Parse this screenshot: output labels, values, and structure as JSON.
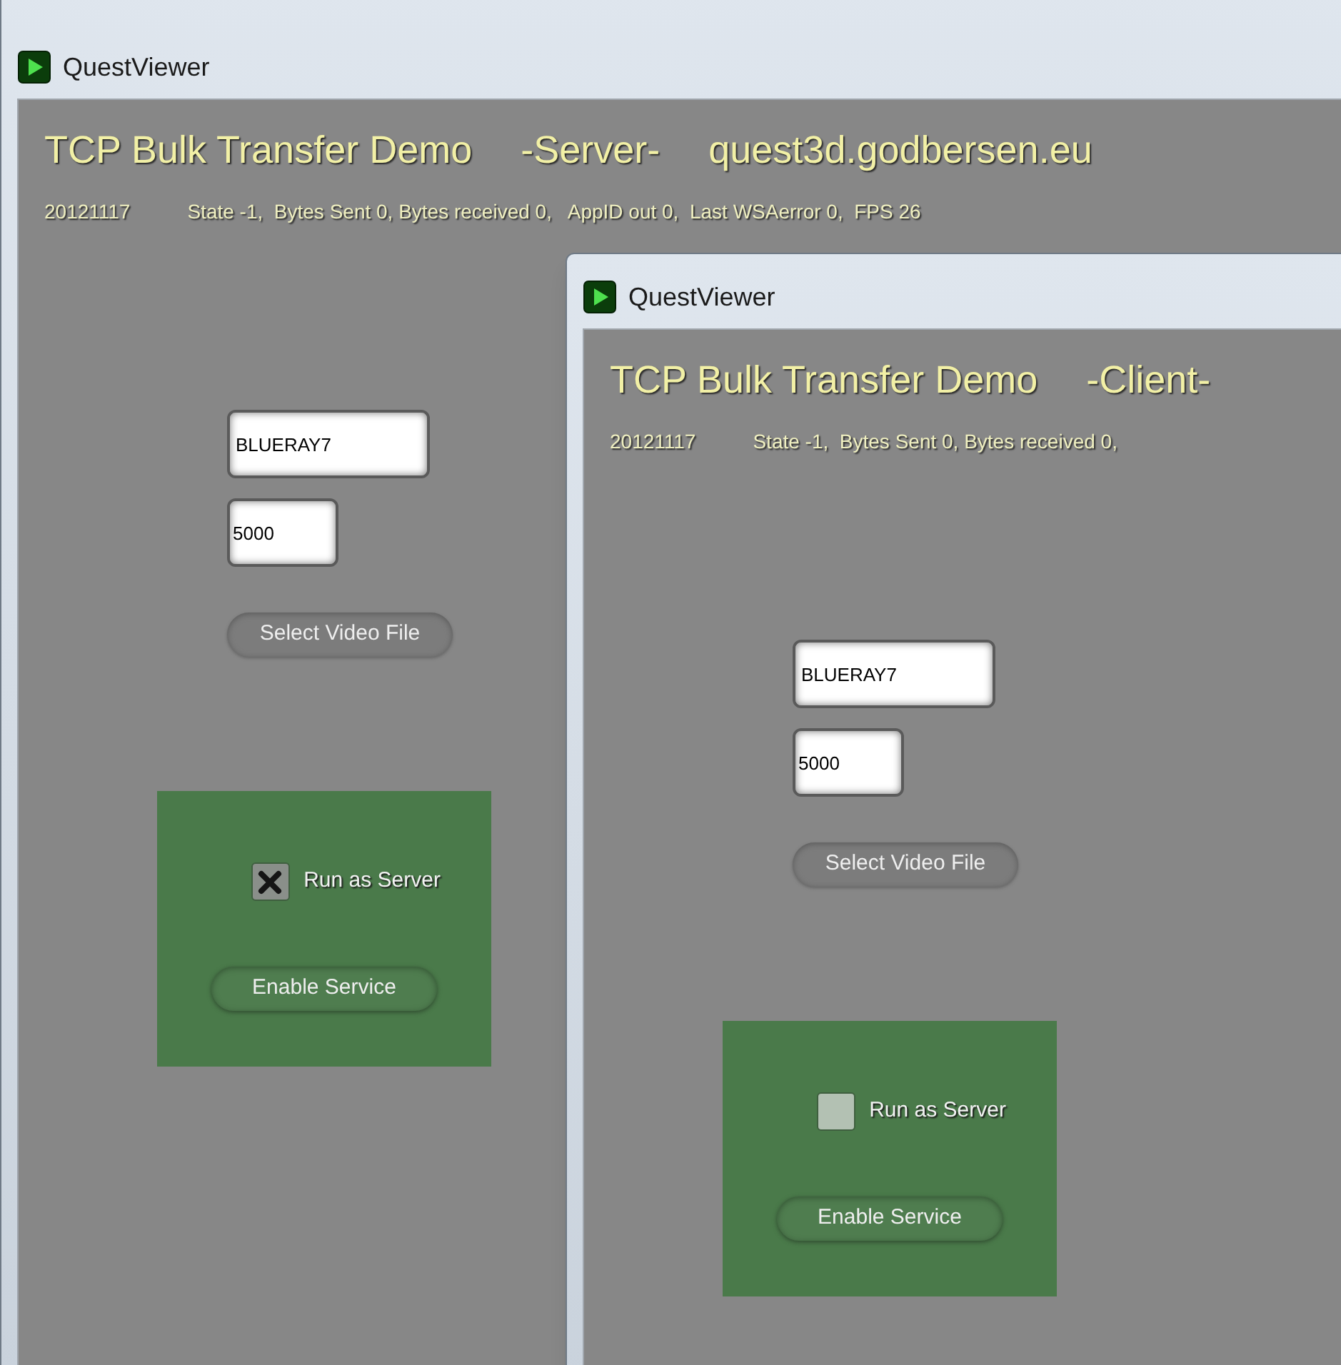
{
  "windows": [
    {
      "title": "QuestViewer",
      "heading": [
        "TCP Bulk Transfer Demo",
        "-Server-",
        "quest3d.godbersen.eu"
      ],
      "status_date": "20121117",
      "status": "State -1,  Bytes Sent 0, Bytes received 0,   AppID out 0,  Last WSAerror 0,  FPS 26",
      "host_field": "BLUERAY7",
      "port_field": "5000",
      "select_button": "Select Video File",
      "checkbox": {
        "label": "Run as Server",
        "checked": true
      },
      "enable_button": "Enable Service"
    },
    {
      "title": "QuestViewer",
      "heading": [
        "TCP Bulk Transfer Demo",
        "-Client-"
      ],
      "status_date": "20121117",
      "status": "State -1,  Bytes Sent 0, Bytes received 0,",
      "host_field": "BLUERAY7",
      "port_field": "5000",
      "select_button": "Select Video File",
      "checkbox": {
        "label": "Run as Server",
        "checked": false
      },
      "enable_button": "Enable Service"
    }
  ]
}
